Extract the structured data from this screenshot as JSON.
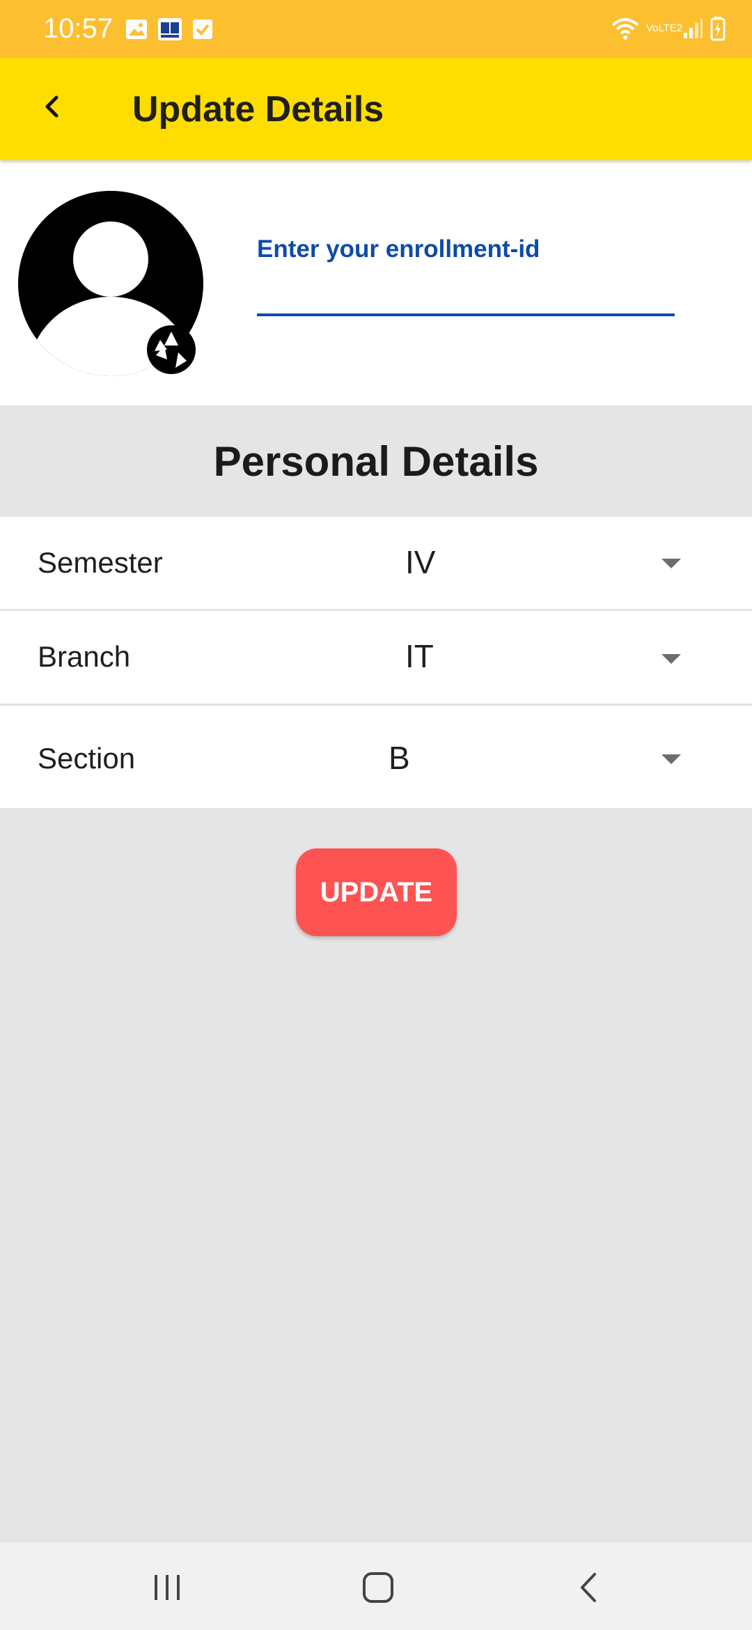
{
  "status_bar": {
    "time": "10:57",
    "left_icons": [
      "gallery-icon",
      "book-app-icon",
      "checkbox-icon"
    ],
    "right_icons": [
      "wifi-icon",
      "volte-icon",
      "signal-icon",
      "battery-charging-icon"
    ],
    "volte_text": "VoLTE2"
  },
  "app_bar": {
    "title": "Update Details",
    "back_icon": "back-arrow-icon"
  },
  "profile": {
    "avatar_icon": "default-avatar-icon",
    "camera_icon": "camera-shutter-icon",
    "enrollment_placeholder": "Enter your enrollment-id"
  },
  "personal_details": {
    "title": "Personal Details",
    "fields": [
      {
        "label": "Semester",
        "value": "IV"
      },
      {
        "label": "Branch",
        "value": "IT"
      },
      {
        "label": "Section",
        "value": "B"
      }
    ]
  },
  "update_button": {
    "label": "UPDATE"
  },
  "nav_bar": {
    "icons": [
      "recent-apps-icon",
      "home-icon",
      "back-icon"
    ]
  },
  "colors": {
    "status_bar": "#fbbf30",
    "app_bar": "#fedd00",
    "accent_blue": "#0e4aa8",
    "update_button": "#fd5352",
    "background": "#e5e5e6"
  }
}
